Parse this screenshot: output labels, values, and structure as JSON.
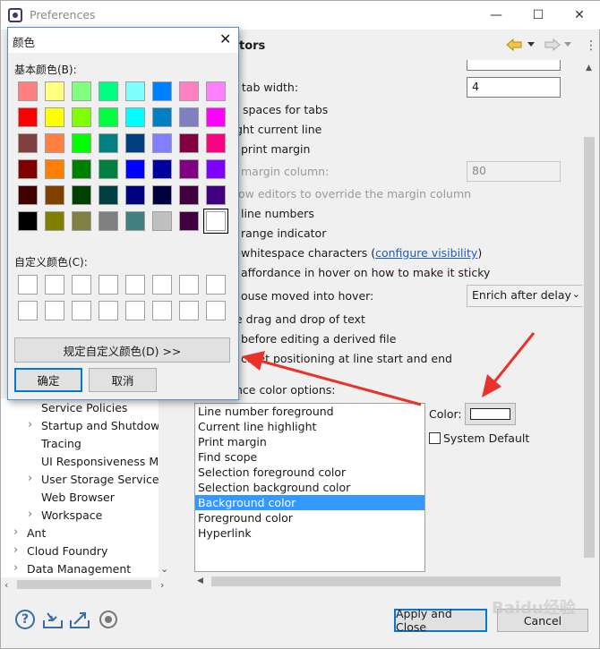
{
  "window": {
    "title": "Preferences",
    "minimize": "—",
    "maximize": "☐",
    "close": "✕"
  },
  "page": {
    "title_partial": "tors"
  },
  "text_editor": {
    "tab_width_label": "d tab width:",
    "tab_width_value": "4",
    "rows": [
      "spaces for tabs",
      "ght current line",
      "print margin",
      "margin column:",
      "ow editors to override the margin column",
      "line numbers",
      "range indicator",
      "whitespace characters",
      "affordance in hover on how to make it sticky",
      "ouse moved into hover:",
      "e drag and drop of text",
      "before editing a derived file",
      "caret positioning at line start and end"
    ],
    "configure_visibility": "configure visibility",
    "paren_open": " (",
    "paren_close": ")",
    "margin_column_value": "80",
    "hover_combo_value": "Enrich after delay",
    "appearance_label": "nce color options:",
    "appearance_items": [
      "Line number foreground",
      "Current line highlight",
      "Print margin",
      "Find scope",
      "Selection foreground color",
      "Selection background color",
      "Background color",
      "Foreground color",
      "Hyperlink"
    ],
    "selected_index": 6,
    "color_label": "Color:",
    "system_default_label": "System Default"
  },
  "tree": {
    "items": [
      {
        "label": "Service Policies",
        "indent": 2,
        "arrow": ""
      },
      {
        "label": "Startup and Shutdown",
        "indent": 2,
        "arrow": "›"
      },
      {
        "label": "Tracing",
        "indent": 2,
        "arrow": ""
      },
      {
        "label": "UI Responsiveness Mc",
        "indent": 2,
        "arrow": ""
      },
      {
        "label": "User Storage Service",
        "indent": 2,
        "arrow": "›"
      },
      {
        "label": "Web Browser",
        "indent": 2,
        "arrow": ""
      },
      {
        "label": "Workspace",
        "indent": 2,
        "arrow": "›"
      },
      {
        "label": "Ant",
        "indent": 1,
        "arrow": "›"
      },
      {
        "label": "Cloud Foundry",
        "indent": 1,
        "arrow": "›"
      },
      {
        "label": "Data Management",
        "indent": 1,
        "arrow": "›"
      }
    ]
  },
  "buttons": {
    "apply_close": "Apply and Close",
    "cancel": "Cancel"
  },
  "color_dialog": {
    "title": "颜色",
    "basic_colors_label": "基本颜色(B):",
    "custom_colors_label": "自定义颜色(C):",
    "define_custom_button": "规定自定义颜色(D) >>",
    "ok_button": "确定",
    "cancel_button": "取消",
    "basic_colors": [
      [
        "#ff8080",
        "#ffff80",
        "#80ff80",
        "#00ff80",
        "#80ffff",
        "#0080ff",
        "#ff80c0",
        "#ff80ff"
      ],
      [
        "#ff0000",
        "#ffff00",
        "#80ff00",
        "#00ff40",
        "#00ffff",
        "#0080c0",
        "#8080c0",
        "#ff00ff"
      ],
      [
        "#804040",
        "#ff8040",
        "#00ff00",
        "#008080",
        "#004080",
        "#8080ff",
        "#800040",
        "#ff0080"
      ],
      [
        "#800000",
        "#ff8000",
        "#008000",
        "#008040",
        "#0000ff",
        "#0000a0",
        "#800080",
        "#8000ff"
      ],
      [
        "#400000",
        "#804000",
        "#004000",
        "#004040",
        "#000080",
        "#000040",
        "#400040",
        "#400080"
      ],
      [
        "#000000",
        "#808000",
        "#808040",
        "#808080",
        "#408080",
        "#c0c0c0",
        "#400040",
        "#ffffff"
      ]
    ]
  },
  "watermark": "Baidu经验"
}
